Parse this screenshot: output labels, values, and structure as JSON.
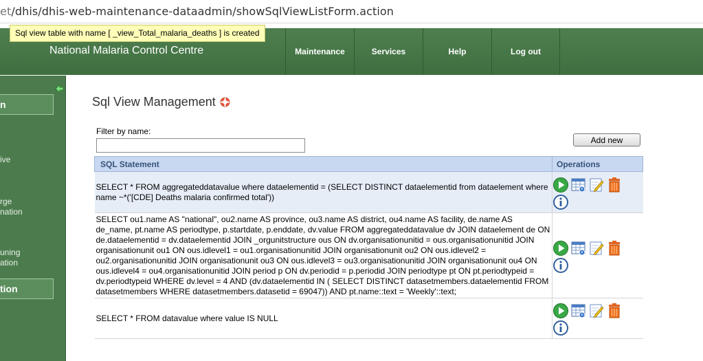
{
  "browser": {
    "url_prefix": "et",
    "url_path": "/dhis/dhis-web-maintenance-dataadmin/showSqlViewListForm.action"
  },
  "message": "Sql view table with name [ _view_Total_malaria_deaths ] is created",
  "header": {
    "title": "National Malaria Control Centre",
    "nav": [
      "Maintenance",
      "Services",
      "Help",
      "Log out"
    ]
  },
  "sidebar": {
    "items": [
      {
        "label": "n"
      },
      {
        "label": "ive"
      },
      {
        "label": "rge\nnation"
      },
      {
        "label": "uning\nation"
      },
      {
        "label": "tion"
      }
    ]
  },
  "main": {
    "title": "Sql View Management",
    "filter_label": "Filter by name:",
    "filter_value": "",
    "add_button": "Add new",
    "columns": [
      "SQL Statement",
      "Operations"
    ],
    "rows": [
      {
        "sql": "SELECT * FROM aggregateddatavalue where dataelementid = (SELECT DISTINCT dataelementid from dataelement where name ~*('[CDE] Deaths malaria confirmed total'))"
      },
      {
        "sql": "SELECT ou1.name AS \"national\", ou2.name AS province, ou3.name AS district, ou4.name AS facility, de.name AS de_name, pt.name AS periodtype, p.startdate, p.enddate, dv.value FROM aggregateddatavalue dv JOIN dataelement de ON de.dataelementid = dv.dataelementid JOIN _orgunitstructure ous ON dv.organisationunitid = ous.organisationunitid JOIN organisationunit ou1 ON ous.idlevel1 = ou1.organisationunitid JOIN organisationunit ou2 ON ous.idlevel2 = ou2.organisationunitid JOIN organisationunit ou3 ON ous.idlevel3 = ou3.organisationunitid JOIN organisationunit ou4 ON ous.idlevel4 = ou4.organisationunitid JOIN period p ON dv.periodid = p.periodid JOIN periodtype pt ON pt.periodtypeid = dv.periodtypeid WHERE dv.level = 4 AND (dv.dataelementid IN ( SELECT DISTINCT datasetmembers.dataelementid FROM datasetmembers WHERE datasetmembers.datasetid = 69047)) AND pt.name::text = 'Weekly'::text;"
      },
      {
        "sql": "SELECT * FROM datavalue where value IS NULL"
      }
    ],
    "operation_icons": [
      "run-icon",
      "view-table-icon",
      "edit-icon",
      "delete-icon",
      "info-icon"
    ]
  }
}
